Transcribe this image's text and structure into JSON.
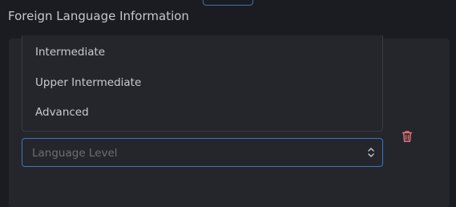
{
  "section": {
    "title": "Foreign Language Information"
  },
  "language_level_dropdown": {
    "options": [
      {
        "label": "Intermediate"
      },
      {
        "label": "Upper Intermediate"
      },
      {
        "label": "Advanced"
      }
    ]
  },
  "language_level_select": {
    "placeholder": "Language Level",
    "chevron_icon": "chevron-up-down-icon"
  },
  "delete_button": {
    "icon": "trash-icon",
    "color": "#e8737a"
  },
  "colors": {
    "accent_border": "#3e74c4",
    "panel_bg": "#25262b",
    "page_bg": "#1b1c21"
  }
}
